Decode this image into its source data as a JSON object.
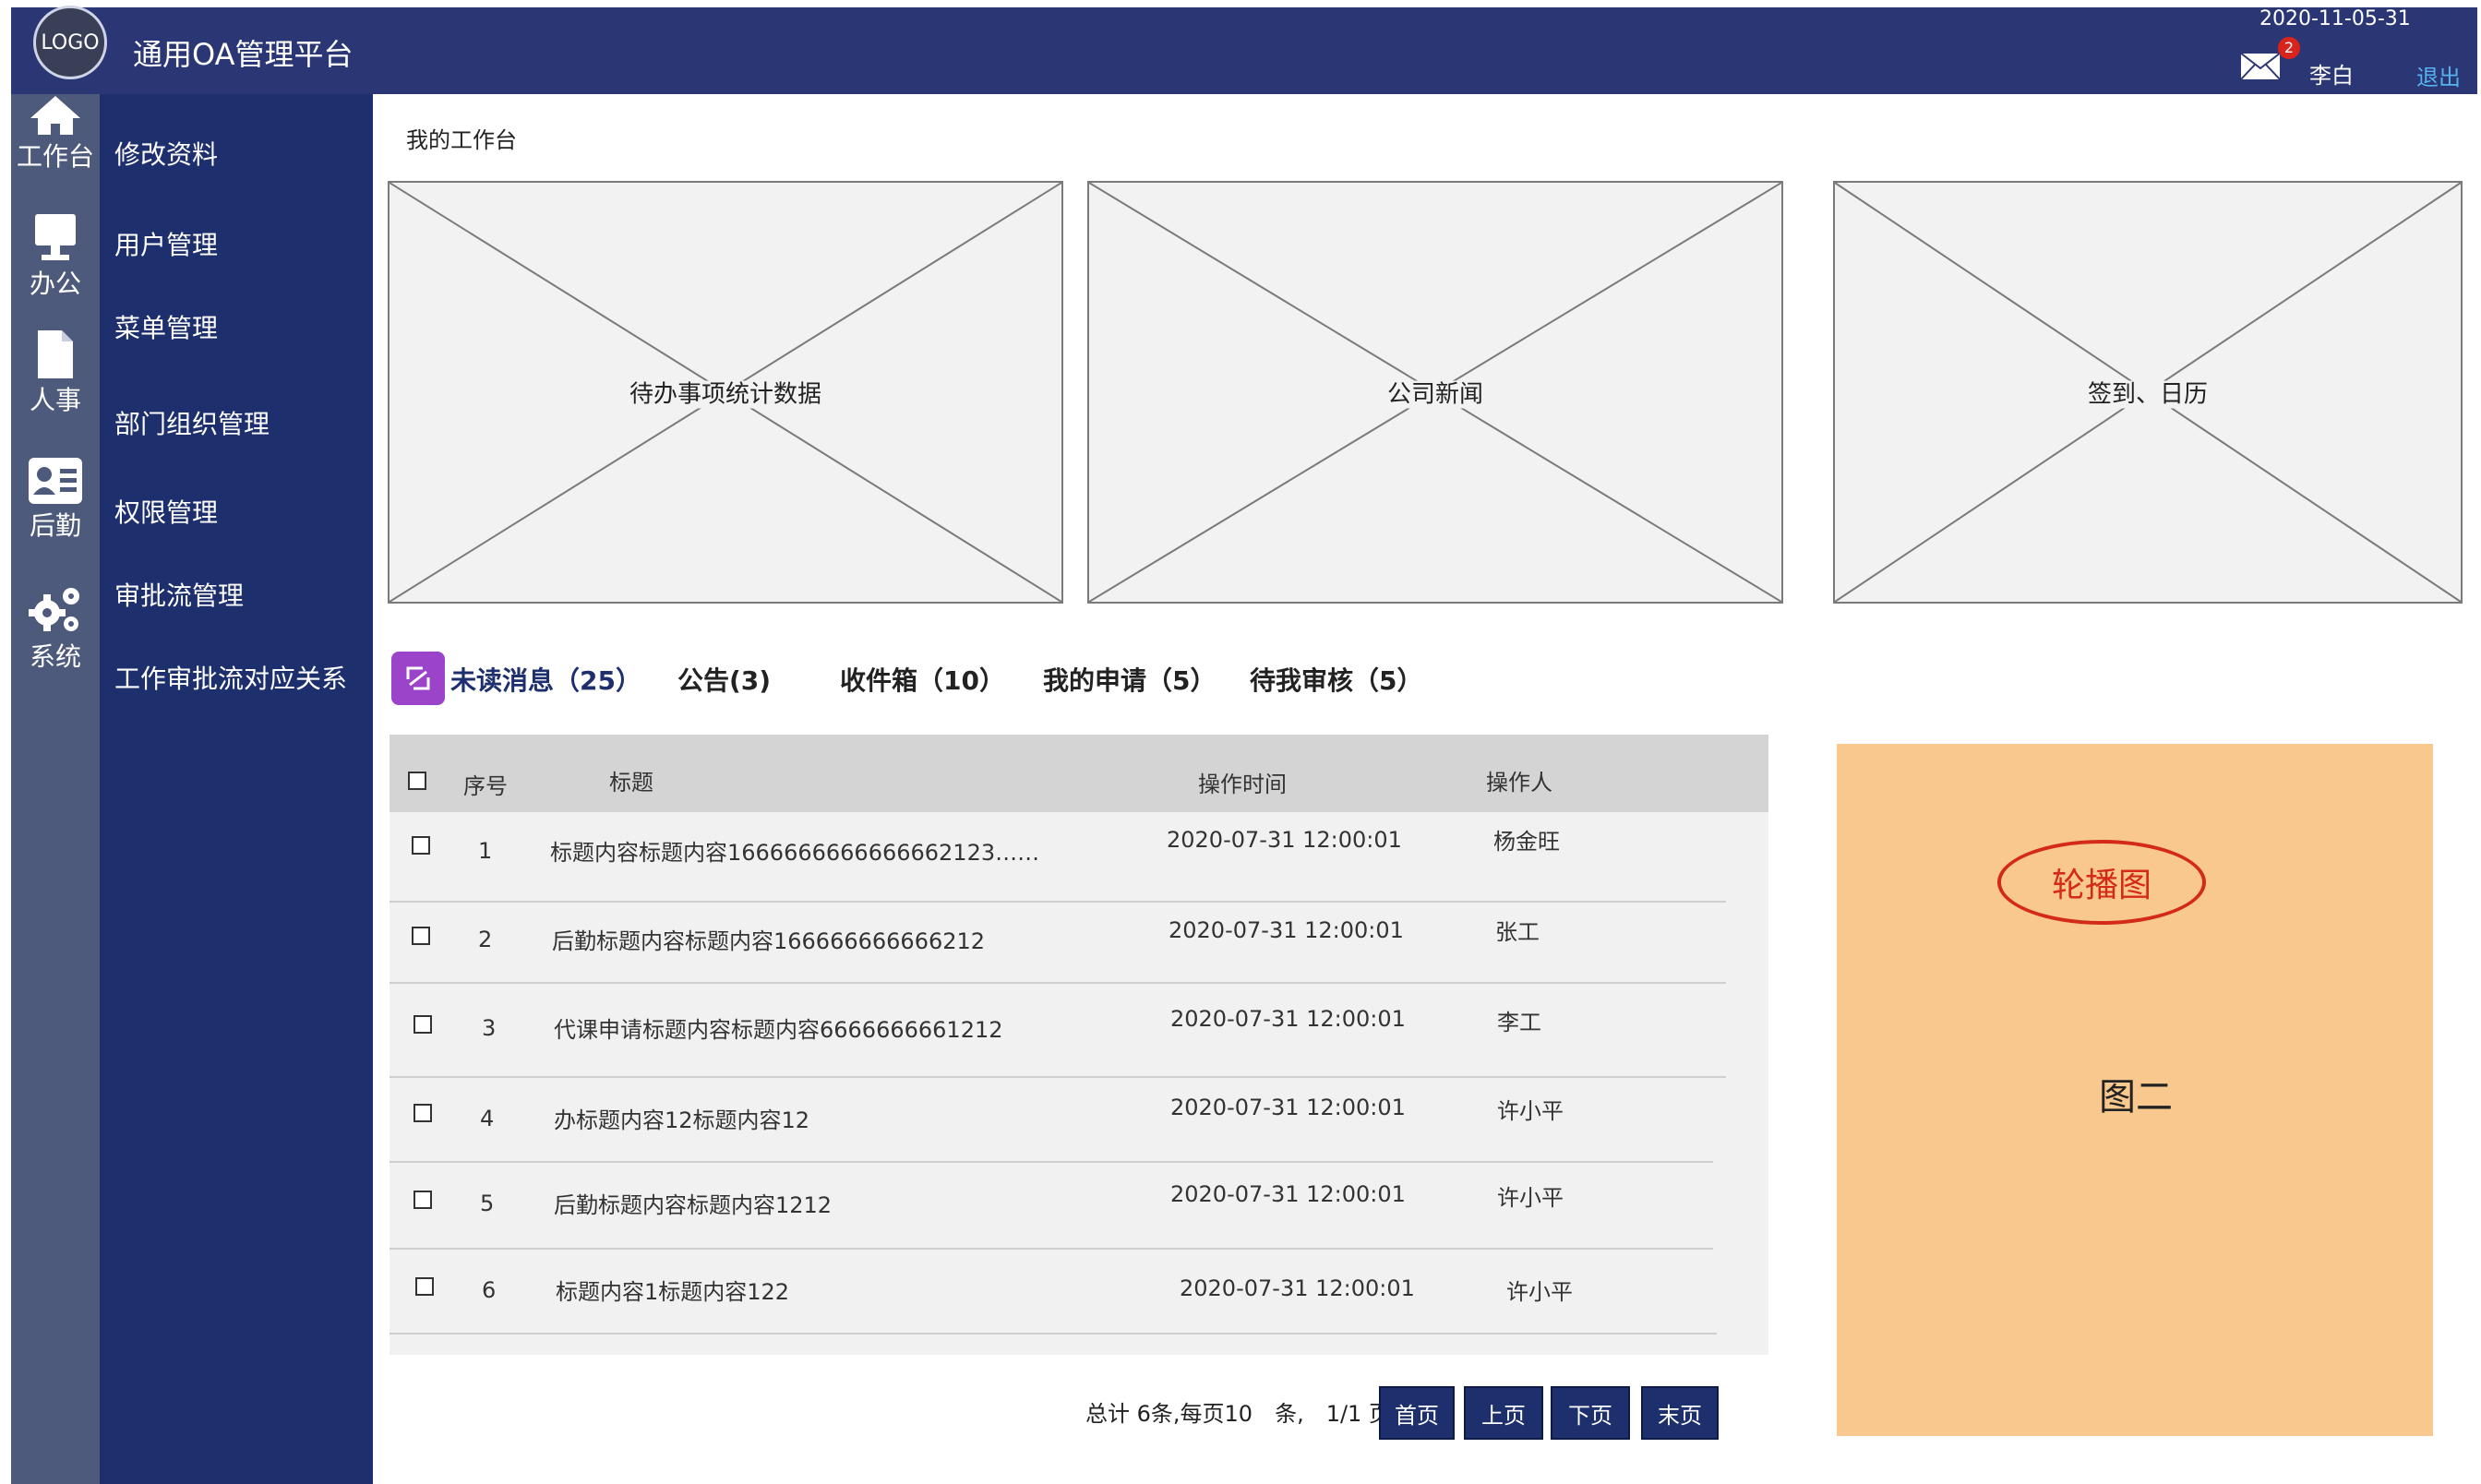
{
  "header": {
    "logo_text": "LOGO",
    "app_title": "通用OA管理平台",
    "date": "2020-11-05-31",
    "mail_count": "2",
    "username": "李白",
    "logout_label": "退出"
  },
  "rail": {
    "items": [
      {
        "label": "工作台",
        "icon": "home-icon"
      },
      {
        "label": "办公",
        "icon": "monitor-icon"
      },
      {
        "label": "人事",
        "icon": "document-icon"
      },
      {
        "label": "后勤",
        "icon": "id-card-icon"
      },
      {
        "label": "系统",
        "icon": "gears-icon"
      }
    ]
  },
  "menu": {
    "items": [
      {
        "label": "修改资料"
      },
      {
        "label": "用户管理"
      },
      {
        "label": "菜单管理"
      },
      {
        "label": "部门组织管理"
      },
      {
        "label": "权限管理"
      },
      {
        "label": "审批流管理"
      },
      {
        "label": "工作审批流对应关系"
      }
    ]
  },
  "breadcrumb": "我的工作台",
  "panels": [
    {
      "caption": "待办事项统计数据"
    },
    {
      "caption": "公司新闻"
    },
    {
      "caption": "签到、日历"
    }
  ],
  "tabs": [
    {
      "label": "未读消息（25）",
      "active": true
    },
    {
      "label": "公告(3)"
    },
    {
      "label": "收件箱（10）"
    },
    {
      "label": "我的申请（5）"
    },
    {
      "label": "待我审核（5）"
    }
  ],
  "table": {
    "columns": [
      "序号",
      "标题",
      "操作时间",
      "操作人"
    ],
    "rows": [
      {
        "no": "1",
        "title": "标题内容标题内容1666666666666662123……",
        "time": "2020-07-31 12:00:01",
        "user": "杨金旺"
      },
      {
        "no": "2",
        "title": "后勤标题内容标题内容166666666666212",
        "time": "2020-07-31 12:00:01",
        "user": "张工"
      },
      {
        "no": "3",
        "title": "代课申请标题内容标题内容6666666661212",
        "time": "2020-07-31 12:00:01",
        "user": "李工"
      },
      {
        "no": "4",
        "title": "办标题内容12标题内容12",
        "time": "2020-07-31 12:00:01",
        "user": "许小平"
      },
      {
        "no": "5",
        "title": "后勤标题内容标题内容1212",
        "time": "2020-07-31 12:00:01",
        "user": "许小平"
      },
      {
        "no": "6",
        "title": "标题内容1标题内容122",
        "time": "2020-07-31 12:00:01",
        "user": "许小平"
      }
    ]
  },
  "pagination": {
    "info": "总计 6条,每页10　条,　1/1 页",
    "first": "首页",
    "prev": "上页",
    "next": "下页",
    "last": "末页"
  },
  "carousel": {
    "label": "轮播图",
    "subtitle": "图二",
    "background": "#f9c88f",
    "accent": "#d32a1a"
  },
  "colors": {
    "topbar": "#2b3674",
    "menu": "#1e2f6e",
    "rail": "#4d5a7b",
    "logout": "#55b4f0",
    "tab_icon": "#9b43c9"
  }
}
